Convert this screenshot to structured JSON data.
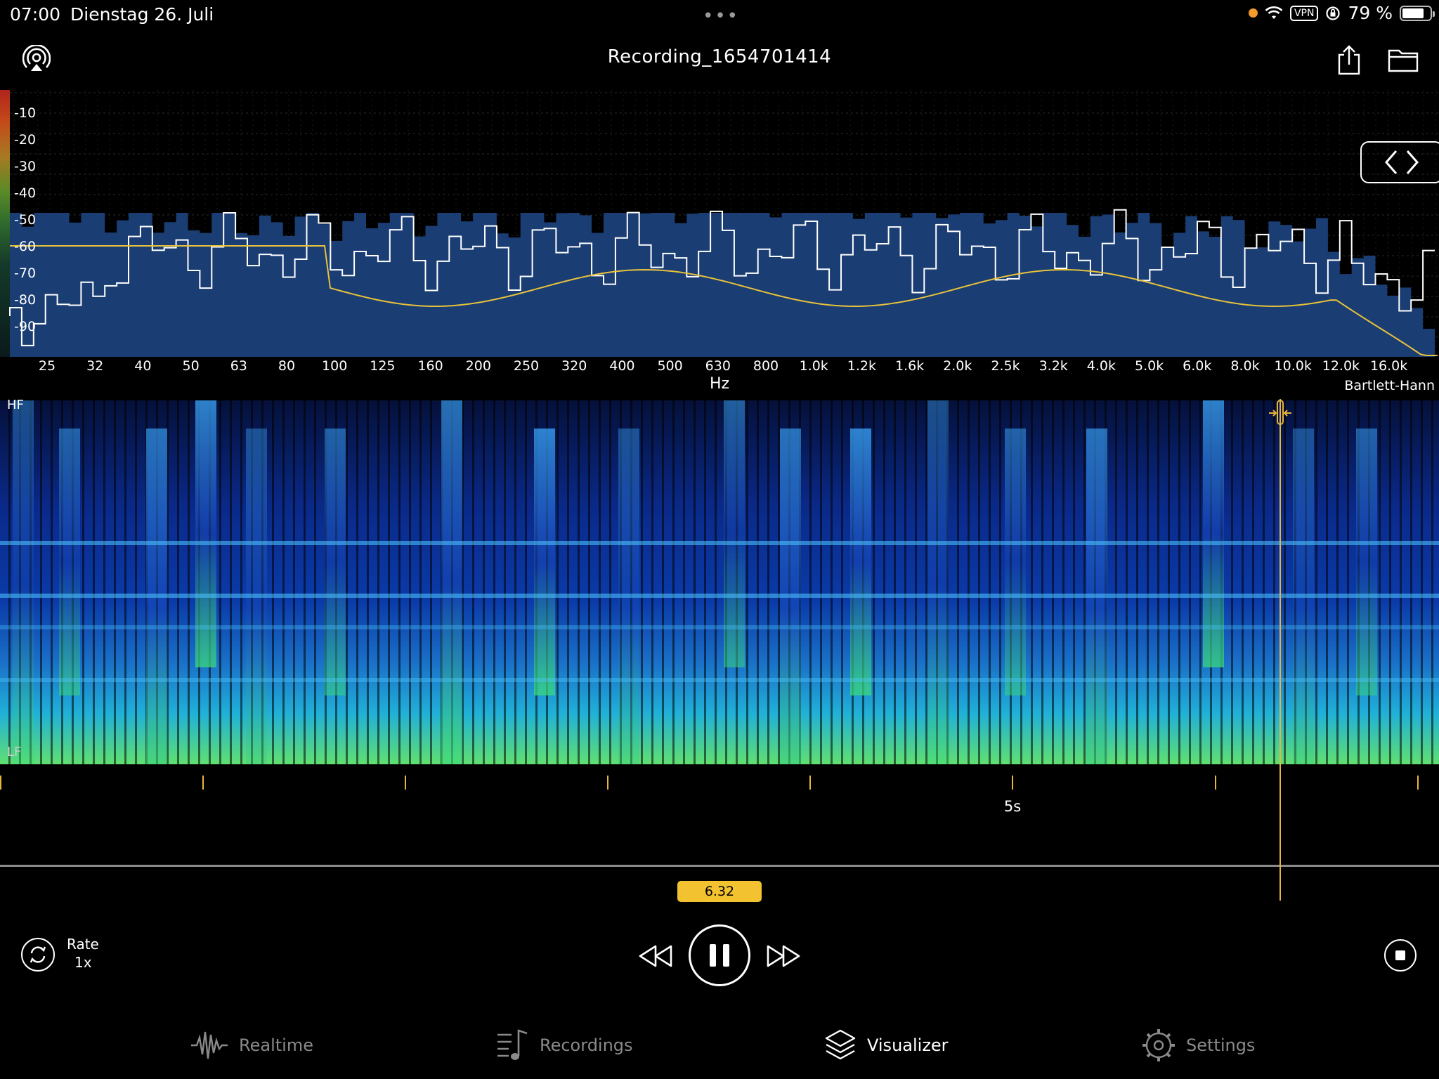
{
  "status": {
    "time": "07:00",
    "date": "Dienstag 26. Juli",
    "vpn": "VPN",
    "battery": "79 %",
    "battery_level": 0.79,
    "icons": [
      "recording-dot-icon",
      "wifi-icon",
      "vpn-icon",
      "rotation-lock-icon",
      "battery-icon"
    ]
  },
  "header": {
    "title": "Recording_1654701414",
    "icons": [
      "airplay-icon",
      "share-icon",
      "folder-icon"
    ]
  },
  "spectrum": {
    "db_ticks": [
      "-10",
      "-20",
      "-30",
      "-40",
      "-50",
      "-60",
      "-70",
      "-80",
      "-90"
    ],
    "hz_ticks": [
      "25",
      "32",
      "40",
      "50",
      "63",
      "80",
      "100",
      "125",
      "160",
      "200",
      "250",
      "320",
      "400",
      "500",
      "630",
      "800",
      "1.0k",
      "1.2k",
      "1.6k",
      "2.0k",
      "2.5k",
      "3.2k",
      "4.0k",
      "5.0k",
      "6.0k",
      "8.0k",
      "10.0k",
      "12.0k",
      "16.0k"
    ],
    "unit": "Hz",
    "window": "Bartlett-Hann",
    "colors": {
      "area": "#173a6e",
      "line": "#ffffff",
      "curve": "#e8c23a"
    }
  },
  "spectrogram": {
    "hf_label": "HF",
    "lf_label": "LF"
  },
  "timeline": {
    "label_5s": "5s",
    "position": "6.32"
  },
  "transport": {
    "rate_label": "Rate",
    "rate_value": "1x",
    "icons": [
      "repeat-icon",
      "rewind-icon",
      "pause-icon",
      "fast-forward-icon",
      "stop-icon"
    ]
  },
  "tabs": [
    {
      "label": "Realtime",
      "icon": "waveform-icon",
      "active": false
    },
    {
      "label": "Recordings",
      "icon": "music-list-icon",
      "active": false
    },
    {
      "label": "Visualizer",
      "icon": "layers-icon",
      "active": true
    },
    {
      "label": "Settings",
      "icon": "gear-icon",
      "active": false
    }
  ],
  "accent": "#e8b53a"
}
